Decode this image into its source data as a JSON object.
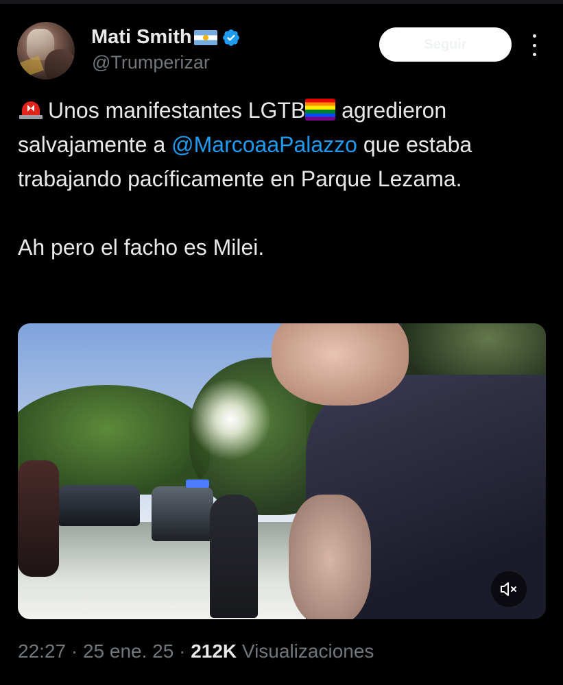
{
  "author": {
    "display_name": "Mati Smith",
    "handle": "@Trumperizar"
  },
  "header": {
    "follow_label": "Seguir"
  },
  "tweet": {
    "part1": "Unos manifestantes LGTB",
    "part2": " agredieron salvajamente a ",
    "mention": "@MarcoaaPalazzo",
    "part3": " que estaba trabajando pacíficamente en Parque Lezama.",
    "paragraph2": "Ah pero el facho es Milei."
  },
  "meta": {
    "time": "22:27",
    "sep1": " · ",
    "date": "25 ene. 25",
    "sep2": " · ",
    "views_count": "212K",
    "views_label": " Visualizaciones"
  },
  "icons": {
    "verified": "verified-badge-icon",
    "more": "more-options-icon",
    "siren": "rotating-light-emoji",
    "rainbow": "rainbow-flag-emoji",
    "flag": "argentina-flag-emoji",
    "mute": "speaker-muted-icon"
  },
  "colors": {
    "background": "#000000",
    "text": "#e7e9ea",
    "secondary": "#71767b",
    "link": "#1d9bf0",
    "verified": "#1d9bf0"
  }
}
